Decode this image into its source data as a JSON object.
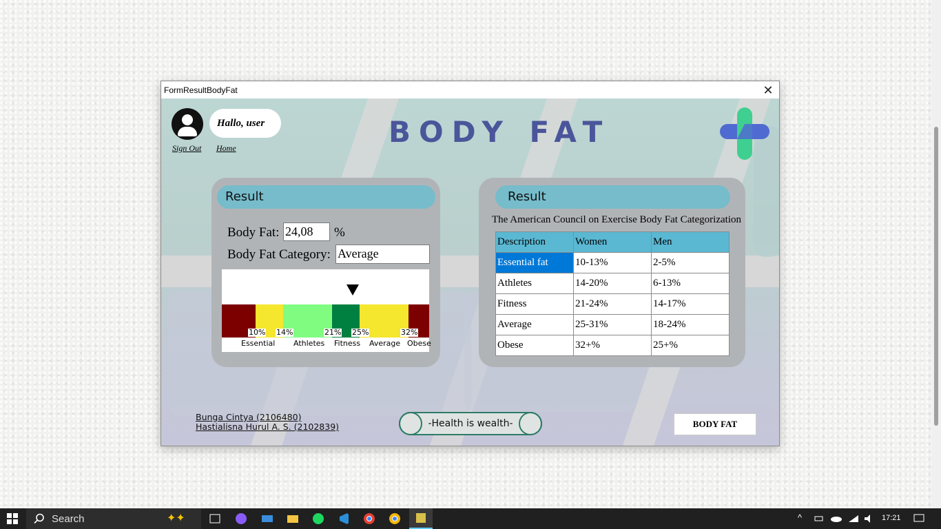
{
  "window": {
    "title": "FormResultBodyFat",
    "close_glyph": "✕"
  },
  "header": {
    "greeting": "Hallo, user",
    "sign_out": "Sign Out",
    "home": "Home",
    "title": "BODY FAT"
  },
  "left_panel": {
    "heading": "Result",
    "body_fat_label": "Body Fat:",
    "body_fat_value": "24,08",
    "unit": "%",
    "category_label": "Body Fat Category:",
    "category_value": "Average",
    "scale": {
      "percentages": [
        "10%",
        "14%",
        "21%",
        "25%",
        "32%"
      ],
      "categories": [
        "Essential",
        "Athletes",
        "Fitness",
        "Average",
        "Obese"
      ],
      "colors": [
        "#7d0000",
        "#f5e62e",
        "#80fd80",
        "#008040",
        "#f5e62e",
        "#7d0000"
      ]
    }
  },
  "right_panel": {
    "heading": "Result",
    "subtitle": "The American Council on Exercise Body Fat Categorization",
    "columns": [
      "Description",
      "Women",
      "Men"
    ],
    "rows": [
      [
        "Essential fat",
        "10-13%",
        "2-5%"
      ],
      [
        "Athletes",
        "14-20%",
        "6-13%"
      ],
      [
        "Fitness",
        "21-24%",
        "14-17%"
      ],
      [
        "Average",
        "25-31%",
        "18-24%"
      ],
      [
        "Obese",
        "32+%",
        "25+%"
      ]
    ]
  },
  "footer": {
    "author1": "Bunga Cintya (2106480)",
    "author2": "Hastialisna Hurul A. S. (2102839)",
    "motto": "-Health is wealth-",
    "button": "BODY FAT"
  },
  "taskbar": {
    "search_placeholder": "Search",
    "time": "17:21"
  }
}
